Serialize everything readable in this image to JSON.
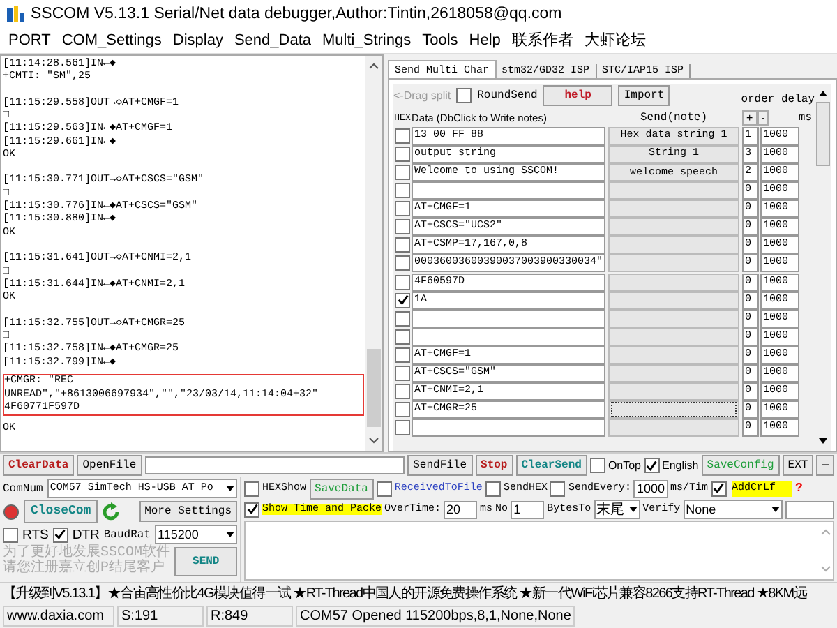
{
  "window": {
    "title": "SSCOM V5.13.1 Serial/Net data debugger,Author:Tintin,2618058@qq.com"
  },
  "menu": [
    "PORT",
    "COM_Settings",
    "Display",
    "Send_Data",
    "Multi_Strings",
    "Tools",
    "Help",
    "联系作者",
    "大虾论坛"
  ],
  "log": {
    "blocks": [
      {
        "highlighted": false,
        "lines": [
          "[11:14:28.561]IN←◆",
          "+CMTI: \"SM\",25"
        ]
      },
      {
        "highlighted": false,
        "lines": [
          "[11:15:29.558]OUT→◇AT+CMGF=1",
          "□",
          "[11:15:29.563]IN←◆AT+CMGF=1",
          "[11:15:29.661]IN←◆",
          "OK"
        ]
      },
      {
        "highlighted": false,
        "lines": [
          "[11:15:30.771]OUT→◇AT+CSCS=\"GSM\"",
          "□",
          "[11:15:30.776]IN←◆AT+CSCS=\"GSM\"",
          "[11:15:30.880]IN←◆",
          "OK"
        ]
      },
      {
        "highlighted": false,
        "lines": [
          "[11:15:31.641]OUT→◇AT+CNMI=2,1",
          "□",
          "[11:15:31.644]IN←◆AT+CNMI=2,1",
          "OK"
        ]
      },
      {
        "highlighted": false,
        "lines": [
          "[11:15:32.755]OUT→◇AT+CMGR=25",
          "□",
          "[11:15:32.758]IN←◆AT+CMGR=25",
          "[11:15:32.799]IN←◆"
        ]
      },
      {
        "highlighted": true,
        "lines": [
          "+CMGR: \"REC",
          "UNREAD\",\"+8613006697934\",\"\",\"23/03/14,11:14:04+32\"",
          "4F60771F597D"
        ]
      },
      {
        "highlighted": false,
        "lines": [
          "OK"
        ]
      }
    ]
  },
  "tabs": [
    {
      "label": "Send Multi Char",
      "selected": true
    },
    {
      "label": "stm32/GD32 ISP",
      "selected": false
    },
    {
      "label": "STC/IAP15 ISP",
      "selected": false
    }
  ],
  "multi_send": {
    "drag_label": "<-Drag split",
    "round_send": {
      "label": "RoundSend",
      "checked": false
    },
    "help_button": "help",
    "import_button": "Import",
    "order_delay_label": "order delay",
    "headers": {
      "hex": "HEX",
      "data": "Data (DbClick to Write notes)",
      "send": "Send(note)",
      "add": "+",
      "remove": "-",
      "ms": "ms"
    },
    "rows": [
      {
        "checked": false,
        "data": "13 00 FF 88",
        "note": "Hex data string 1",
        "order": "1",
        "delay": "1000",
        "focused": false
      },
      {
        "checked": false,
        "data": "output string",
        "note": "String 1",
        "order": "3",
        "delay": "1000",
        "focused": false
      },
      {
        "checked": false,
        "data": "Welcome to using SSCOM!",
        "note": "welcome speech",
        "order": "2",
        "delay": "1000",
        "focused": false
      },
      {
        "checked": false,
        "order": "0",
        "delay": "1000",
        "focused": false
      },
      {
        "checked": false,
        "data": "AT+CMGF=1",
        "order": "0",
        "delay": "1000",
        "focused": false
      },
      {
        "checked": false,
        "data": "AT+CSCS=\"UCS2\"",
        "order": "0",
        "delay": "1000",
        "focused": false
      },
      {
        "checked": false,
        "data": "AT+CSMP=17,167,0,8",
        "order": "0",
        "delay": "1000",
        "focused": false
      },
      {
        "checked": false,
        "data": "00036003600390037003900330034\"",
        "order": "0",
        "delay": "1000",
        "focused": false
      },
      {
        "checked": false,
        "data": "4F60597D",
        "order": "0",
        "delay": "1000",
        "focused": false
      },
      {
        "checked": true,
        "data": "1A",
        "order": "0",
        "delay": "1000",
        "focused": false
      },
      {
        "checked": false,
        "order": "0",
        "delay": "1000",
        "focused": false
      },
      {
        "checked": false,
        "order": "0",
        "delay": "1000",
        "focused": false
      },
      {
        "checked": false,
        "data": "AT+CMGF=1",
        "order": "0",
        "delay": "1000",
        "focused": false
      },
      {
        "checked": false,
        "data": "AT+CSCS=\"GSM\"",
        "order": "0",
        "delay": "1000",
        "focused": false
      },
      {
        "checked": false,
        "data": "AT+CNMI=2,1",
        "order": "0",
        "delay": "1000",
        "focused": false
      },
      {
        "checked": false,
        "data": "AT+CMGR=25",
        "order": "0",
        "delay": "1000",
        "focused": true
      },
      {
        "checked": false,
        "order": "0",
        "delay": "1000",
        "focused": false
      }
    ]
  },
  "toolbar": {
    "clear_data": "ClearData",
    "open_file": "OpenFile",
    "send_file": "SendFile",
    "stop": "Stop",
    "clear_send": "ClearSend",
    "on_top": {
      "label": "OnTop",
      "checked": false
    },
    "english": {
      "label": "English",
      "checked": true
    },
    "save_config": "SaveConfig",
    "ext": "EXT",
    "minimize": "—"
  },
  "port_panel": {
    "com_label": "ComNum",
    "com_value": "COM57 SimTech HS-USB AT Po",
    "close_button": "CloseCom",
    "more_settings": "More Settings",
    "rts": {
      "label": "RTS",
      "checked": false
    },
    "dtr": {
      "label": "DTR",
      "checked": true
    },
    "baud_label": "BaudRat",
    "baud_value": "115200",
    "promo": [
      "为了更好地发展SSCOM软件",
      "请您注册嘉立创P结尾客户"
    ],
    "send_button": "SEND"
  },
  "options": {
    "hex_show": {
      "label": "HEXShow",
      "checked": false
    },
    "save_data": "SaveData",
    "received_to_file": {
      "label": "ReceivedToFile",
      "checked": false
    },
    "send_hex": {
      "label": "SendHEX",
      "checked": false
    },
    "send_every": {
      "label": "SendEvery:",
      "checked": false
    },
    "interval": "1000",
    "interval_unit": "ms/Tim",
    "add_crlf": {
      "label": "AddCrLf",
      "checked": true
    },
    "help_mark": "?",
    "show_time": {
      "label": "Show Time and Packe",
      "checked": true
    },
    "overtime_label": "OverTime:",
    "overtime": "20",
    "overtime_unit": "ms",
    "no_label": "No",
    "no_value": "1",
    "bytes_label": "BytesTo",
    "bytes_value": "末尾",
    "verify_label": "Verify",
    "verify_value": "None"
  },
  "ticker": "【升级到V5.13.1】★合宙高性价比4G模块值得一试 ★RT-Thread中国人的开源免费操作系统 ★新一代WiFi芯片兼容8266支持RT-Thread ★8KM远",
  "status_bar": [
    "www.daxia.com",
    "S:191",
    "R:849",
    "COM57 Opened 115200bps,8,1,None,None"
  ]
}
